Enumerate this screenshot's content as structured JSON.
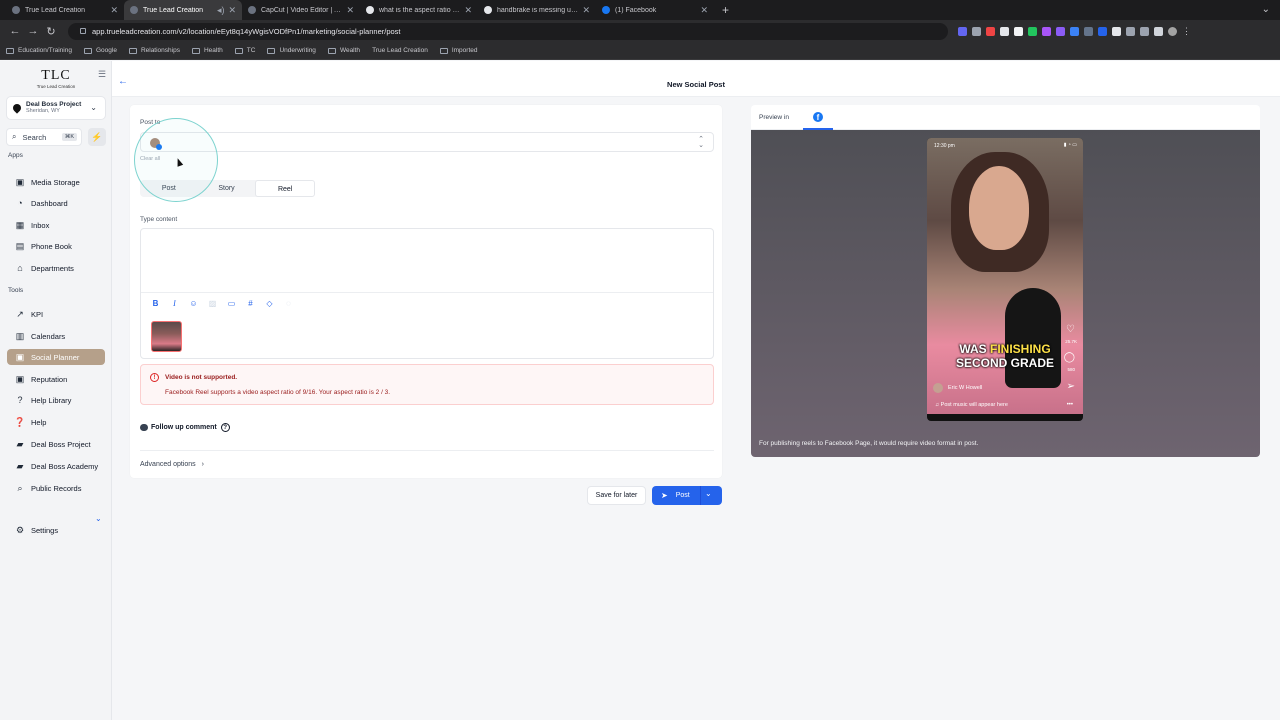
{
  "browser": {
    "tabs": [
      {
        "title": "True Lead Creation",
        "favicon": "tlc",
        "active": false
      },
      {
        "title": "True Lead Creation",
        "favicon": "tlc",
        "active": true
      },
      {
        "title": "CapCut | Video Editor | All-in",
        "favicon": "capcut",
        "active": false
      },
      {
        "title": "what is the aspect ratio for fa",
        "favicon": "google",
        "active": false
      },
      {
        "title": "handbrake is messing up my",
        "favicon": "google",
        "active": false
      },
      {
        "title": "(1) Facebook",
        "favicon": "facebook",
        "active": false
      }
    ],
    "url": "app.trueleadcreation.com/v2/location/eEyt8q14yWgisVODfPn1/marketing/social-planner/post",
    "bookmarks": [
      "Education/Training",
      "Google",
      "Relationships",
      "Health",
      "TC",
      "Underwriting",
      "Wealth",
      "True Lead Creation",
      "Imported"
    ]
  },
  "sidebar": {
    "logo_mark": "TLC",
    "logo_text": "True Lead Creation",
    "location_name": "Deal Boss Project",
    "location_city": "Sheridan, WY",
    "search_label": "Search",
    "search_shortcut": "⌘K",
    "apps_heading": "Apps",
    "tools_heading": "Tools",
    "apps": [
      {
        "label": "Media Storage",
        "icon": "image-icon"
      },
      {
        "label": "Dashboard",
        "icon": "dashboard-icon"
      },
      {
        "label": "Inbox",
        "icon": "inbox-icon"
      },
      {
        "label": "Phone Book",
        "icon": "phone-book-icon"
      },
      {
        "label": "Departments",
        "icon": "departments-icon"
      }
    ],
    "tools": [
      {
        "label": "KPI",
        "icon": "chart-icon"
      },
      {
        "label": "Calendars",
        "icon": "calendar-icon"
      },
      {
        "label": "Social Planner",
        "icon": "social-icon",
        "active": true
      },
      {
        "label": "Reputation",
        "icon": "reputation-icon"
      },
      {
        "label": "Help Library",
        "icon": "question-icon"
      },
      {
        "label": "Help",
        "icon": "help-icon"
      },
      {
        "label": "Deal Boss Project",
        "icon": "project-icon"
      },
      {
        "label": "Deal Boss Academy",
        "icon": "academy-icon"
      },
      {
        "label": "Public Records",
        "icon": "magnifier-icon"
      }
    ],
    "settings_label": "Settings"
  },
  "page": {
    "title": "New Social Post"
  },
  "composer": {
    "post_to_label": "Post to",
    "clear_all": "Clear all",
    "post_types": [
      "Post",
      "Story",
      "Reel"
    ],
    "selected_type": "Reel",
    "content_label": "Type content",
    "error_title": "Video is not supported.",
    "error_detail": "Facebook Reel supports a video aspect ratio of 9/16. Your aspect ratio is 2 / 3.",
    "follow_up_label": "Follow up comment",
    "advanced_label": "Advanced options",
    "save_label": "Save for later",
    "post_label": "Post"
  },
  "preview": {
    "label": "Preview in",
    "platform_icon": "facebook-icon",
    "status_time": "12:30 pm",
    "caption_word1": "WAS",
    "caption_word2": "FINISHING",
    "caption_line2": "SECOND GRADE",
    "likes": "25.7K",
    "comments": "580",
    "author": "Eric W Howell",
    "music": "Post music will appear here",
    "note": "For publishing reels to Facebook Page, it would require video format in post."
  },
  "colors": {
    "accent": "#2563eb",
    "active_nav": "#b5a08a",
    "error": "#991b1b",
    "facebook": "#1877f2"
  }
}
